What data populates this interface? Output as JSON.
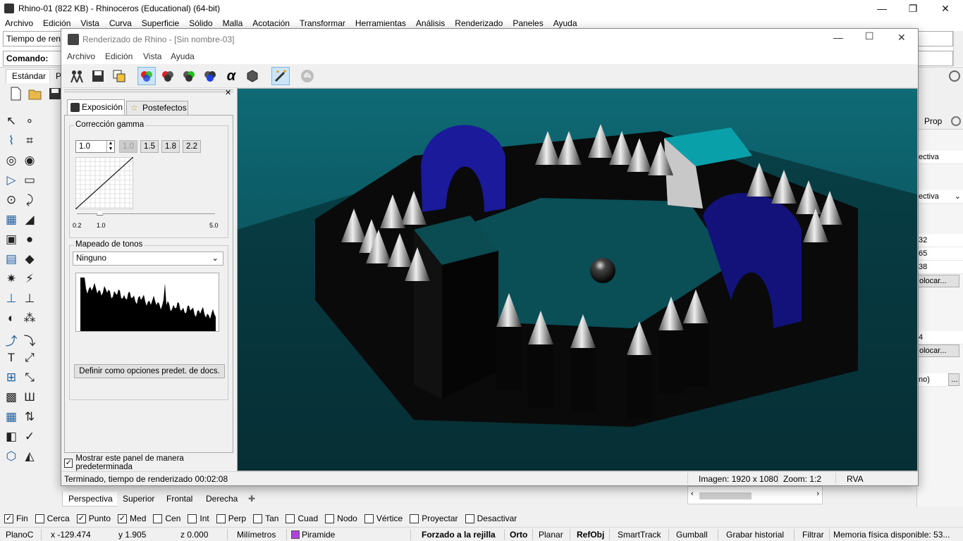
{
  "app": {
    "title": "Rhino-01 (822 KB) - Rhinoceros (Educational) (64-bit)",
    "menu": [
      "Archivo",
      "Edición",
      "Vista",
      "Curva",
      "Superficie",
      "Sólido",
      "Malla",
      "Acotación",
      "Transformar",
      "Herramientas",
      "Análisis",
      "Renderizado",
      "Paneles",
      "Ayuda"
    ],
    "cmd_history": "Tiempo de ren",
    "cmd_label": "Comando:",
    "toolbar_tabs": [
      "Estándar",
      "Pl"
    ]
  },
  "right_panel": {
    "tab": "Prop",
    "rows": [
      "ectiva",
      "ectiva",
      "32",
      "65",
      "38",
      "olocar...",
      "4",
      "olocar...",
      "no)"
    ],
    "button": "..."
  },
  "viewport_tabs": [
    "Perspectiva",
    "Superior",
    "Frontal",
    "Derecha"
  ],
  "osnaps": [
    {
      "label": "Fin",
      "checked": true
    },
    {
      "label": "Cerca",
      "checked": false
    },
    {
      "label": "Punto",
      "checked": true
    },
    {
      "label": "Med",
      "checked": true
    },
    {
      "label": "Cen",
      "checked": false
    },
    {
      "label": "Int",
      "checked": false
    },
    {
      "label": "Perp",
      "checked": false
    },
    {
      "label": "Tan",
      "checked": false
    },
    {
      "label": "Cuad",
      "checked": false
    },
    {
      "label": "Nodo",
      "checked": false
    },
    {
      "label": "Vértice",
      "checked": false
    },
    {
      "label": "Proyectar",
      "checked": false
    },
    {
      "label": "Desactivar",
      "checked": false
    }
  ],
  "status": {
    "plane": "PlanoC",
    "x": "x -129.474",
    "y": "y 1.905",
    "z": "z 0.000",
    "units": "Milímetros",
    "layer": "Piramide",
    "layer_color": "#b040e0",
    "grid_snap": "Forzado a la rejilla",
    "ortho": "Orto",
    "planar": "Planar",
    "osnap": "RefObj",
    "smarttrack": "SmartTrack",
    "gumball": "Gumball",
    "history": "Grabar historial",
    "filter": "Filtrar",
    "memory": "Memoria física disponible: 53..."
  },
  "render_window": {
    "title": "Renderizado de Rhino - [Sin nombre-03]",
    "menu": [
      "Archivo",
      "Edición",
      "Vista",
      "Ayuda"
    ],
    "tabs": [
      "Exposición",
      "Postefectos"
    ],
    "gamma_group": "Corrección gamma",
    "gamma_value": "1.0",
    "gamma_presets": [
      "1.0",
      "1.5",
      "1.8",
      "2.2"
    ],
    "slider_min": "0.2",
    "slider_cur": "1.0",
    "slider_max": "5.0",
    "gamma_level": 1.0,
    "tone_group": "Mapeado de tonos",
    "tone_value": "Ninguno",
    "default_button": "Definir como opciones predet. de docs.",
    "show_default": "Mostrar este panel de manera predeterminada",
    "status_left": "Terminado, tiempo de renderizado 00:02:08",
    "status_image": "Imagen: 1920 x 1080",
    "status_zoom": "Zoom: 1:2",
    "status_mode": "RVA"
  },
  "colors": {
    "accent": "#0078d7",
    "scene_teal": "#0b5560",
    "arch_blue": "#1a1a9a"
  }
}
